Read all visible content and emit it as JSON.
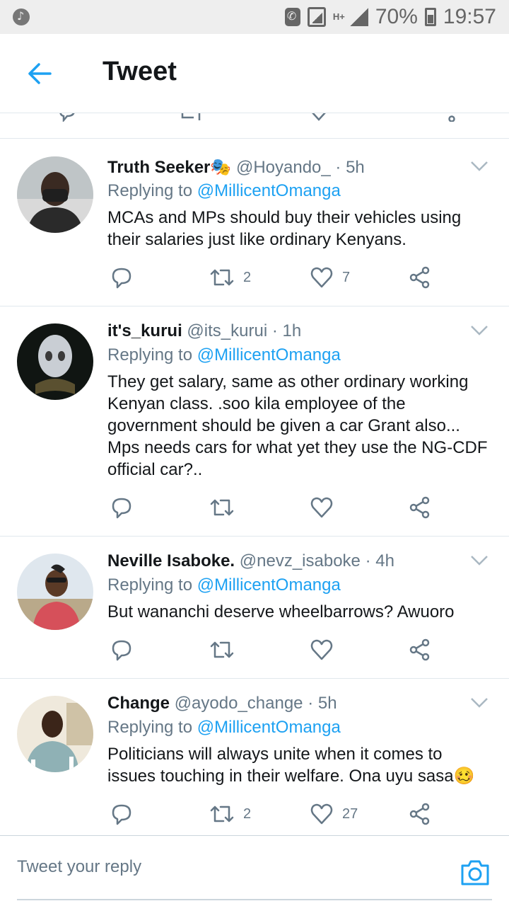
{
  "statusbar": {
    "battery": "70%",
    "time": "19:57",
    "network": "H+"
  },
  "header": {
    "title": "Tweet"
  },
  "colors": {
    "accent": "#1da1f2",
    "secondary_text": "#657786",
    "divider": "#e1e8ed"
  },
  "tweets": [
    {
      "name": "Truth Seeker🎭",
      "handle": "@Hoyando_",
      "time": "· 5h",
      "replying_label": "Replying to",
      "replying_to": "@MillicentOmanga",
      "text": "MCAs and MPs should buy their vehicles using their salaries just like ordinary Kenyans.",
      "retweets": "2",
      "likes": "7"
    },
    {
      "name": "it's_kurui",
      "handle": "@its_kurui",
      "time": "· 1h",
      "replying_label": "Replying to",
      "replying_to": "@MillicentOmanga",
      "text": "They get salary, same as other ordinary working Kenyan class. .soo kila employee of the government should be given a car Grant also... Mps needs cars for what yet they use the NG-CDF official car?..",
      "retweets": "",
      "likes": ""
    },
    {
      "name": "Neville Isaboke.",
      "handle": "@nevz_isaboke",
      "time": "· 4h",
      "replying_label": "Replying to",
      "replying_to": "@MillicentOmanga",
      "text": "But wananchi deserve wheelbarrows? Awuoro",
      "retweets": "",
      "likes": ""
    },
    {
      "name": "Change",
      "handle": "@ayodo_change",
      "time": "· 5h",
      "replying_label": "Replying to",
      "replying_to": "@MillicentOmanga",
      "text": "Politicians will always unite when it comes to issues touching in their welfare. Ona uyu sasa🥴",
      "retweets": "2",
      "likes": "27"
    }
  ],
  "reply": {
    "placeholder": "Tweet your reply"
  },
  "icons": [
    "back-arrow-icon",
    "chevron-down-icon",
    "reply-icon",
    "retweet-icon",
    "heart-icon",
    "share-icon",
    "camera-icon"
  ]
}
